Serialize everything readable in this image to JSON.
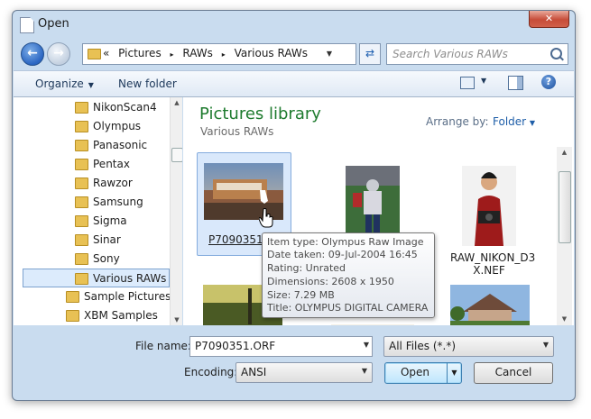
{
  "window": {
    "title": "Open",
    "close_glyph": "✕"
  },
  "nav": {
    "back_glyph": "←",
    "forward_glyph": "→",
    "breadcrumb": [
      "«",
      "Pictures",
      "▸",
      "RAWs",
      "▸",
      "Various RAWs"
    ],
    "search_placeholder": "Search Various RAWs"
  },
  "toolbar": {
    "organize": "Organize",
    "new_folder": "New folder",
    "help_glyph": "?"
  },
  "sidebar": {
    "items": [
      {
        "label": "NikonScan4"
      },
      {
        "label": "Olympus"
      },
      {
        "label": "Panasonic"
      },
      {
        "label": "Pentax"
      },
      {
        "label": "Rawzor"
      },
      {
        "label": "Samsung"
      },
      {
        "label": "Sigma"
      },
      {
        "label": "Sinar"
      },
      {
        "label": "Sony"
      },
      {
        "label": "Various RAWs"
      },
      {
        "label": "Sample Pictures"
      },
      {
        "label": "XBM Samples"
      }
    ]
  },
  "library": {
    "title": "Pictures library",
    "subtitle": "Various RAWs",
    "arrange_label": "Arrange by:",
    "arrange_value": "Folder"
  },
  "files": [
    {
      "name": "P7090351.ORF",
      "label_visible": "P7090351.O",
      "selected": true
    },
    {
      "name": "",
      "label_visible": ""
    },
    {
      "name": "RAW_NIKON_D3\nX.NEF",
      "line1": "RAW_NIKON_D3",
      "line2": "X.NEF"
    }
  ],
  "tooltip": {
    "lines": [
      "Item type: Olympus Raw Image",
      "Date taken: 09-Jul-2004 16:45",
      "Rating: Unrated",
      "Dimensions: 2608 x 1950",
      "Size: 7.29 MB",
      "Title: OLYMPUS DIGITAL CAMERA"
    ]
  },
  "form": {
    "file_name_label": "File name:",
    "file_name_value": "P7090351.ORF",
    "file_type_value": "All Files  (*.*)",
    "encoding_label": "Encoding:",
    "encoding_value": "ANSI",
    "open_label": "Open",
    "cancel_label": "Cancel"
  },
  "colors": {
    "chrome": "#c9dcef",
    "library_title": "#1e7b2e",
    "link": "#1e5ea8"
  }
}
